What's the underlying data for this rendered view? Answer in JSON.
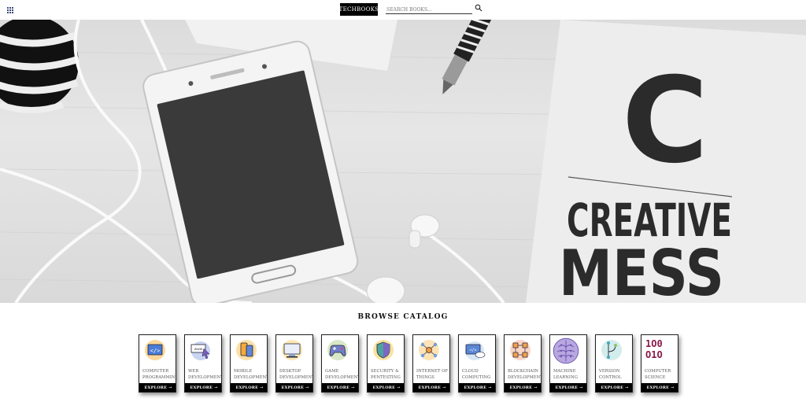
{
  "header": {
    "menu_icon": "grid-icon",
    "brand": "TECHBOOKS",
    "search_placeholder": "SEARCH BOOKS...",
    "search_icon": "search-icon"
  },
  "hero": {
    "notebook_letter": "C",
    "notebook_line1": "CREATIVE",
    "notebook_line2": "MESS"
  },
  "catalog": {
    "title": "BROWSE CATALOG",
    "explore_label": "EXPLORE →",
    "categories": [
      {
        "line1": "COMPUTER",
        "line2": "PROGRAMMING",
        "icon": "code-window-icon"
      },
      {
        "line1": "WEB",
        "line2": "DEVELOPMENT",
        "icon": "web-cursor-icon"
      },
      {
        "line1": "MOBILE",
        "line2": "DEVELOPMENT",
        "icon": "mobile-devices-icon"
      },
      {
        "line1": "DESKTOP",
        "line2": "DEVELOPMENT",
        "icon": "desktop-monitor-icon"
      },
      {
        "line1": "GAME",
        "line2": "DEVELOPMENT",
        "icon": "gamepad-icon"
      },
      {
        "line1": "SECURITY &",
        "line2": "PENTESTING",
        "icon": "shield-icon"
      },
      {
        "line1": "INTERNET OF",
        "line2": "THINGS",
        "icon": "iot-network-icon"
      },
      {
        "line1": "CLOUD",
        "line2": "COMPUTING",
        "icon": "cloud-code-icon"
      },
      {
        "line1": "BLOCKCHAIN",
        "line2": "DEVELOPMENT",
        "icon": "blockchain-icon"
      },
      {
        "line1": "MACHINE",
        "line2": "LEARNING",
        "icon": "brain-icon"
      },
      {
        "line1": "VERSION",
        "line2": "CONTROL",
        "icon": "branch-icon"
      },
      {
        "line1": "COMPUTER",
        "line2": "SCIENCE",
        "icon": "binary-icon",
        "binary_top": "1O0",
        "binary_bottom": "O1O"
      }
    ]
  },
  "colors": {
    "brand_bg": "#000000",
    "binary": "#8b1a4a"
  }
}
